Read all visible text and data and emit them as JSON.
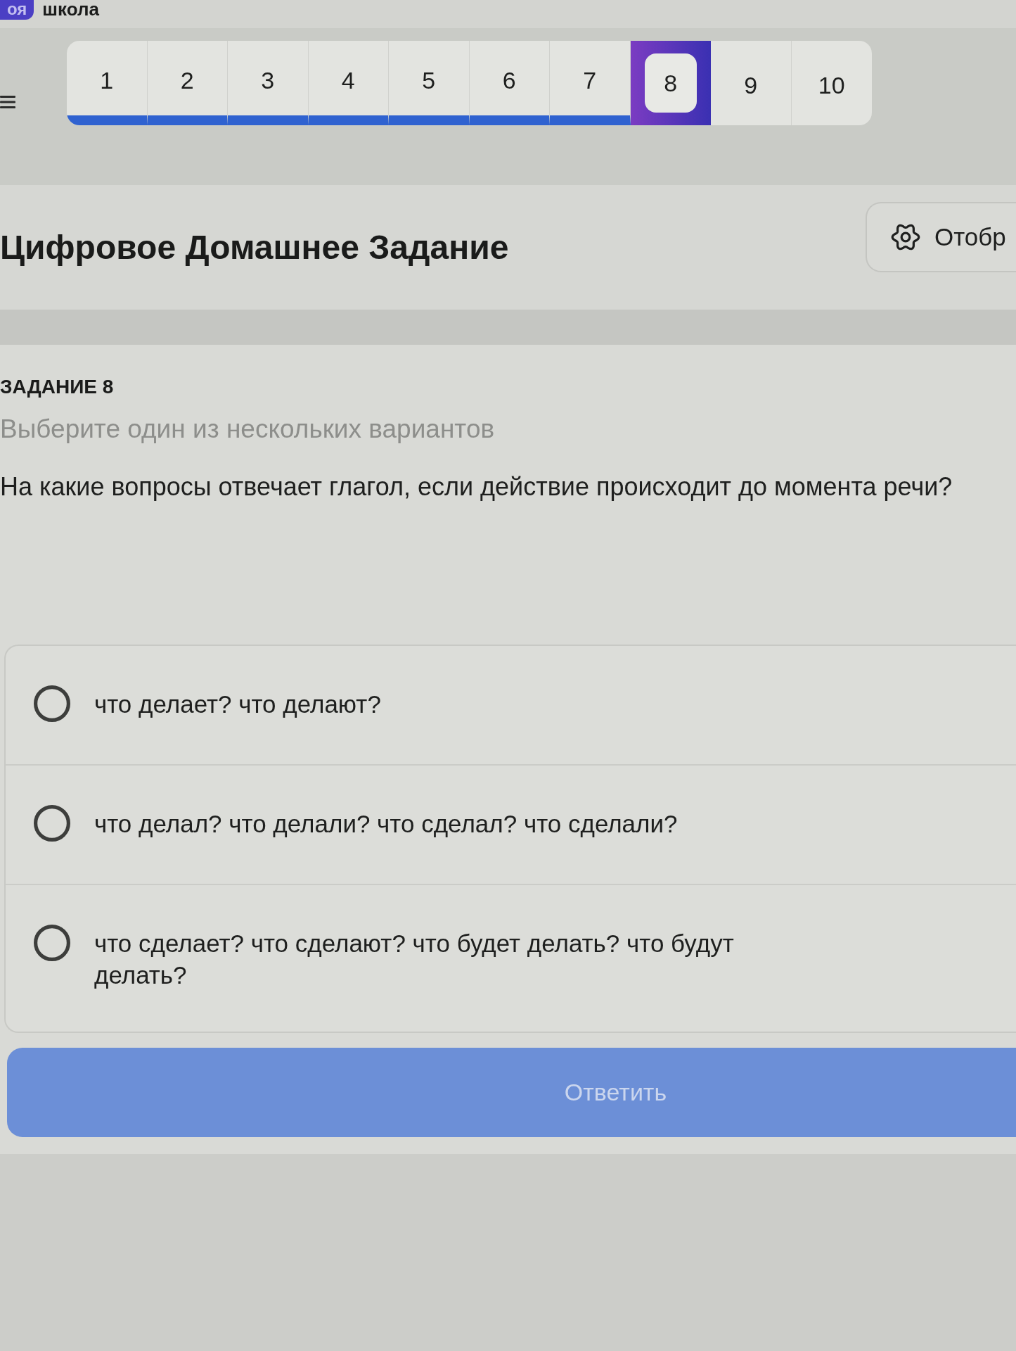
{
  "header": {
    "logo_badge": "оя",
    "title": "школа"
  },
  "task_nav": {
    "items": [
      {
        "label": "1",
        "answered": true,
        "selected": false
      },
      {
        "label": "2",
        "answered": true,
        "selected": false
      },
      {
        "label": "3",
        "answered": true,
        "selected": false
      },
      {
        "label": "4",
        "answered": true,
        "selected": false
      },
      {
        "label": "5",
        "answered": true,
        "selected": false
      },
      {
        "label": "6",
        "answered": true,
        "selected": false
      },
      {
        "label": "7",
        "answered": true,
        "selected": false
      },
      {
        "label": "8",
        "answered": false,
        "selected": true
      },
      {
        "label": "9",
        "answered": false,
        "selected": false
      },
      {
        "label": "10",
        "answered": false,
        "selected": false
      }
    ]
  },
  "page": {
    "title": "Цифровое Домашнее Задание",
    "display_button": {
      "label": "Отобр"
    }
  },
  "task": {
    "heading": "ЗАДАНИЕ 8",
    "instruction": "Выберите один из нескольких вариантов",
    "question": "На какие вопросы отвечает глагол, если действие происходит до момента речи?",
    "options": [
      {
        "text": "что делает? что делают?",
        "selected": false
      },
      {
        "text": "что делал? что делали? что сделал? что сделали?",
        "selected": false
      },
      {
        "text": "что сделает? что сделают? что будет делать? что будут делать?",
        "selected": false
      }
    ]
  },
  "submit_button": {
    "label": "Ответить",
    "disabled": true
  }
}
